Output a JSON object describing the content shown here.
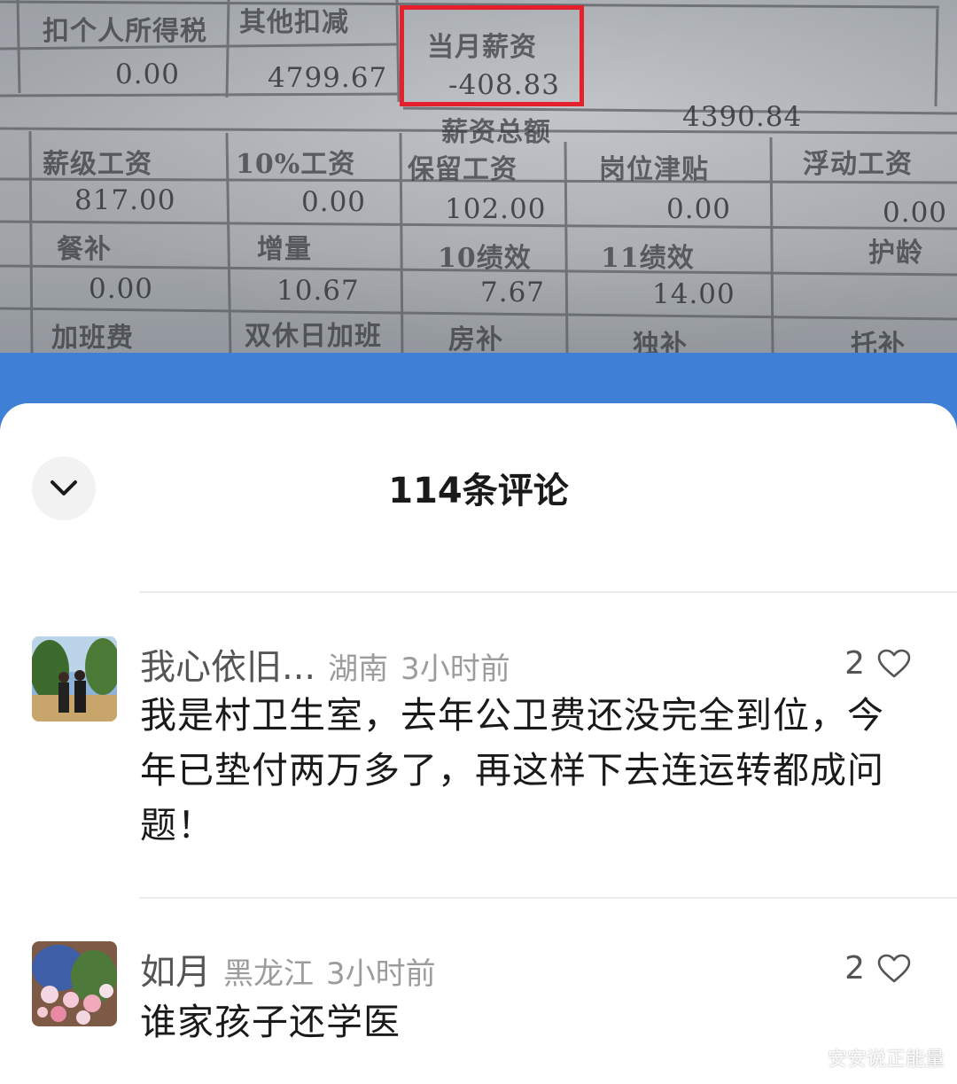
{
  "payslip": {
    "row1_labels": [
      "扣个人所得税",
      "其他扣减",
      "当月薪资"
    ],
    "row1_values": [
      "0.00",
      "4799.67",
      "-408.83"
    ],
    "total_label": "薪资总额",
    "total_value": "4390.84",
    "row2_labels": [
      "薪级工资",
      "10%工资",
      "保留工资",
      "岗位津贴",
      "浮动工资"
    ],
    "row2_values": [
      "817.00",
      "0.00",
      "102.00",
      "0.00",
      "0.00"
    ],
    "row3_labels": [
      "餐补",
      "增量",
      "10绩效",
      "11绩效",
      "护龄"
    ],
    "row3_values": [
      "0.00",
      "10.67",
      "7.67",
      "14.00"
    ],
    "row4_labels": [
      "加班费",
      "双休日加班",
      "房补",
      "独补",
      "托补"
    ],
    "highlight_color": "#e3202b"
  },
  "sheet": {
    "title": "114条评论",
    "collapse_icon": "chevron-down-icon"
  },
  "comments": [
    {
      "username": "我心依旧...",
      "region": "湖南",
      "time": "3小时前",
      "likes": "2",
      "text": "我是村卫生室，去年公卫费还没完全到位，今年已垫付两万多了，再这样下去连运转都成问题！"
    },
    {
      "username": "如月",
      "region": "黑龙江",
      "time": "3小时前",
      "likes": "2",
      "text": "谁家孩子还学医"
    }
  ],
  "watermark": "安安说正能量"
}
